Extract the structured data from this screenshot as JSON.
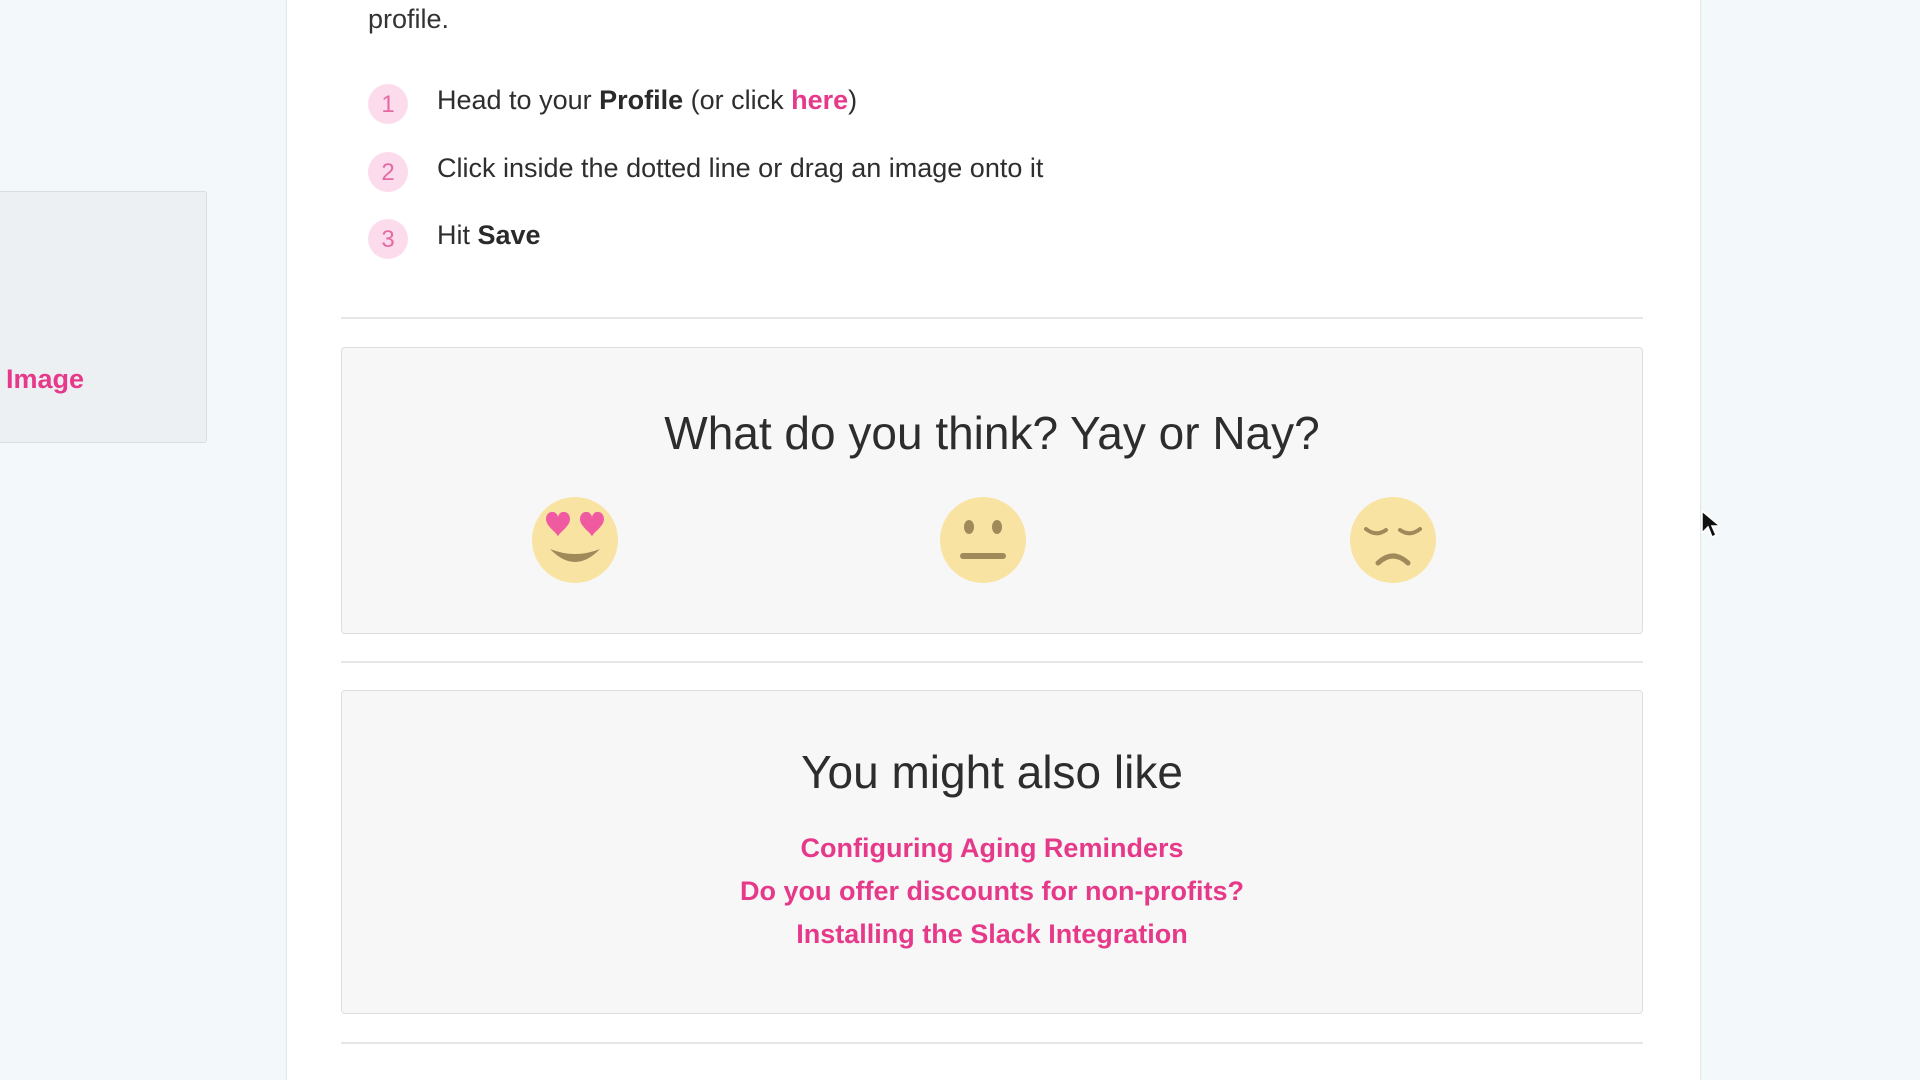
{
  "sidebar": {
    "link_label": "Image"
  },
  "article": {
    "intro_tail": "profile.",
    "steps": [
      {
        "number": "1",
        "prefix": "Head to your ",
        "bold": "Profile",
        "middle": " (or click ",
        "link": "here",
        "suffix": ")"
      },
      {
        "number": "2",
        "text": "Click inside the dotted line or drag an image onto it"
      },
      {
        "number": "3",
        "prefix": "Hit ",
        "bold": "Save"
      }
    ]
  },
  "feedback": {
    "title": "What do you think? Yay or Nay?",
    "options": [
      {
        "icon": "heart-eyes-emoji-icon"
      },
      {
        "icon": "neutral-face-emoji-icon"
      },
      {
        "icon": "sad-face-emoji-icon"
      }
    ]
  },
  "related": {
    "title": "You might also like",
    "links": [
      "Configuring Aging Reminders",
      "Do you offer discounts for non-profits?",
      "Installing the Slack Integration"
    ]
  },
  "colors": {
    "accent": "#e6398a",
    "step_badge_bg": "#fcdcec",
    "emoji_face": "#f9e3a3",
    "panel_bg": "#f7f7f7"
  }
}
